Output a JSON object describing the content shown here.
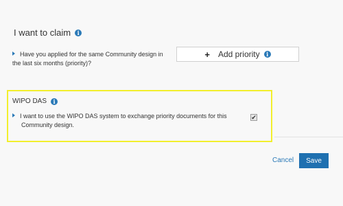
{
  "claim_section": {
    "title": "I want to claim",
    "question_line1": "Have you applied for the same Community design in",
    "question_line2": "the last six months (priority)?",
    "add_priority_label": "Add priority"
  },
  "wipo_section": {
    "title": "WIPO DAS",
    "text_line1": "I want to use the WIPO DAS system to exchange priority documents for this",
    "text_line2": "Community design.",
    "checkbox_checked": true,
    "checkbox_mark": "✔"
  },
  "footer": {
    "cancel_label": "Cancel",
    "save_label": "Save"
  },
  "icons": {
    "info": "i"
  },
  "colors": {
    "accent": "#2a79b7",
    "save_button": "#1f70b0",
    "highlight": "#f2ef2c"
  }
}
